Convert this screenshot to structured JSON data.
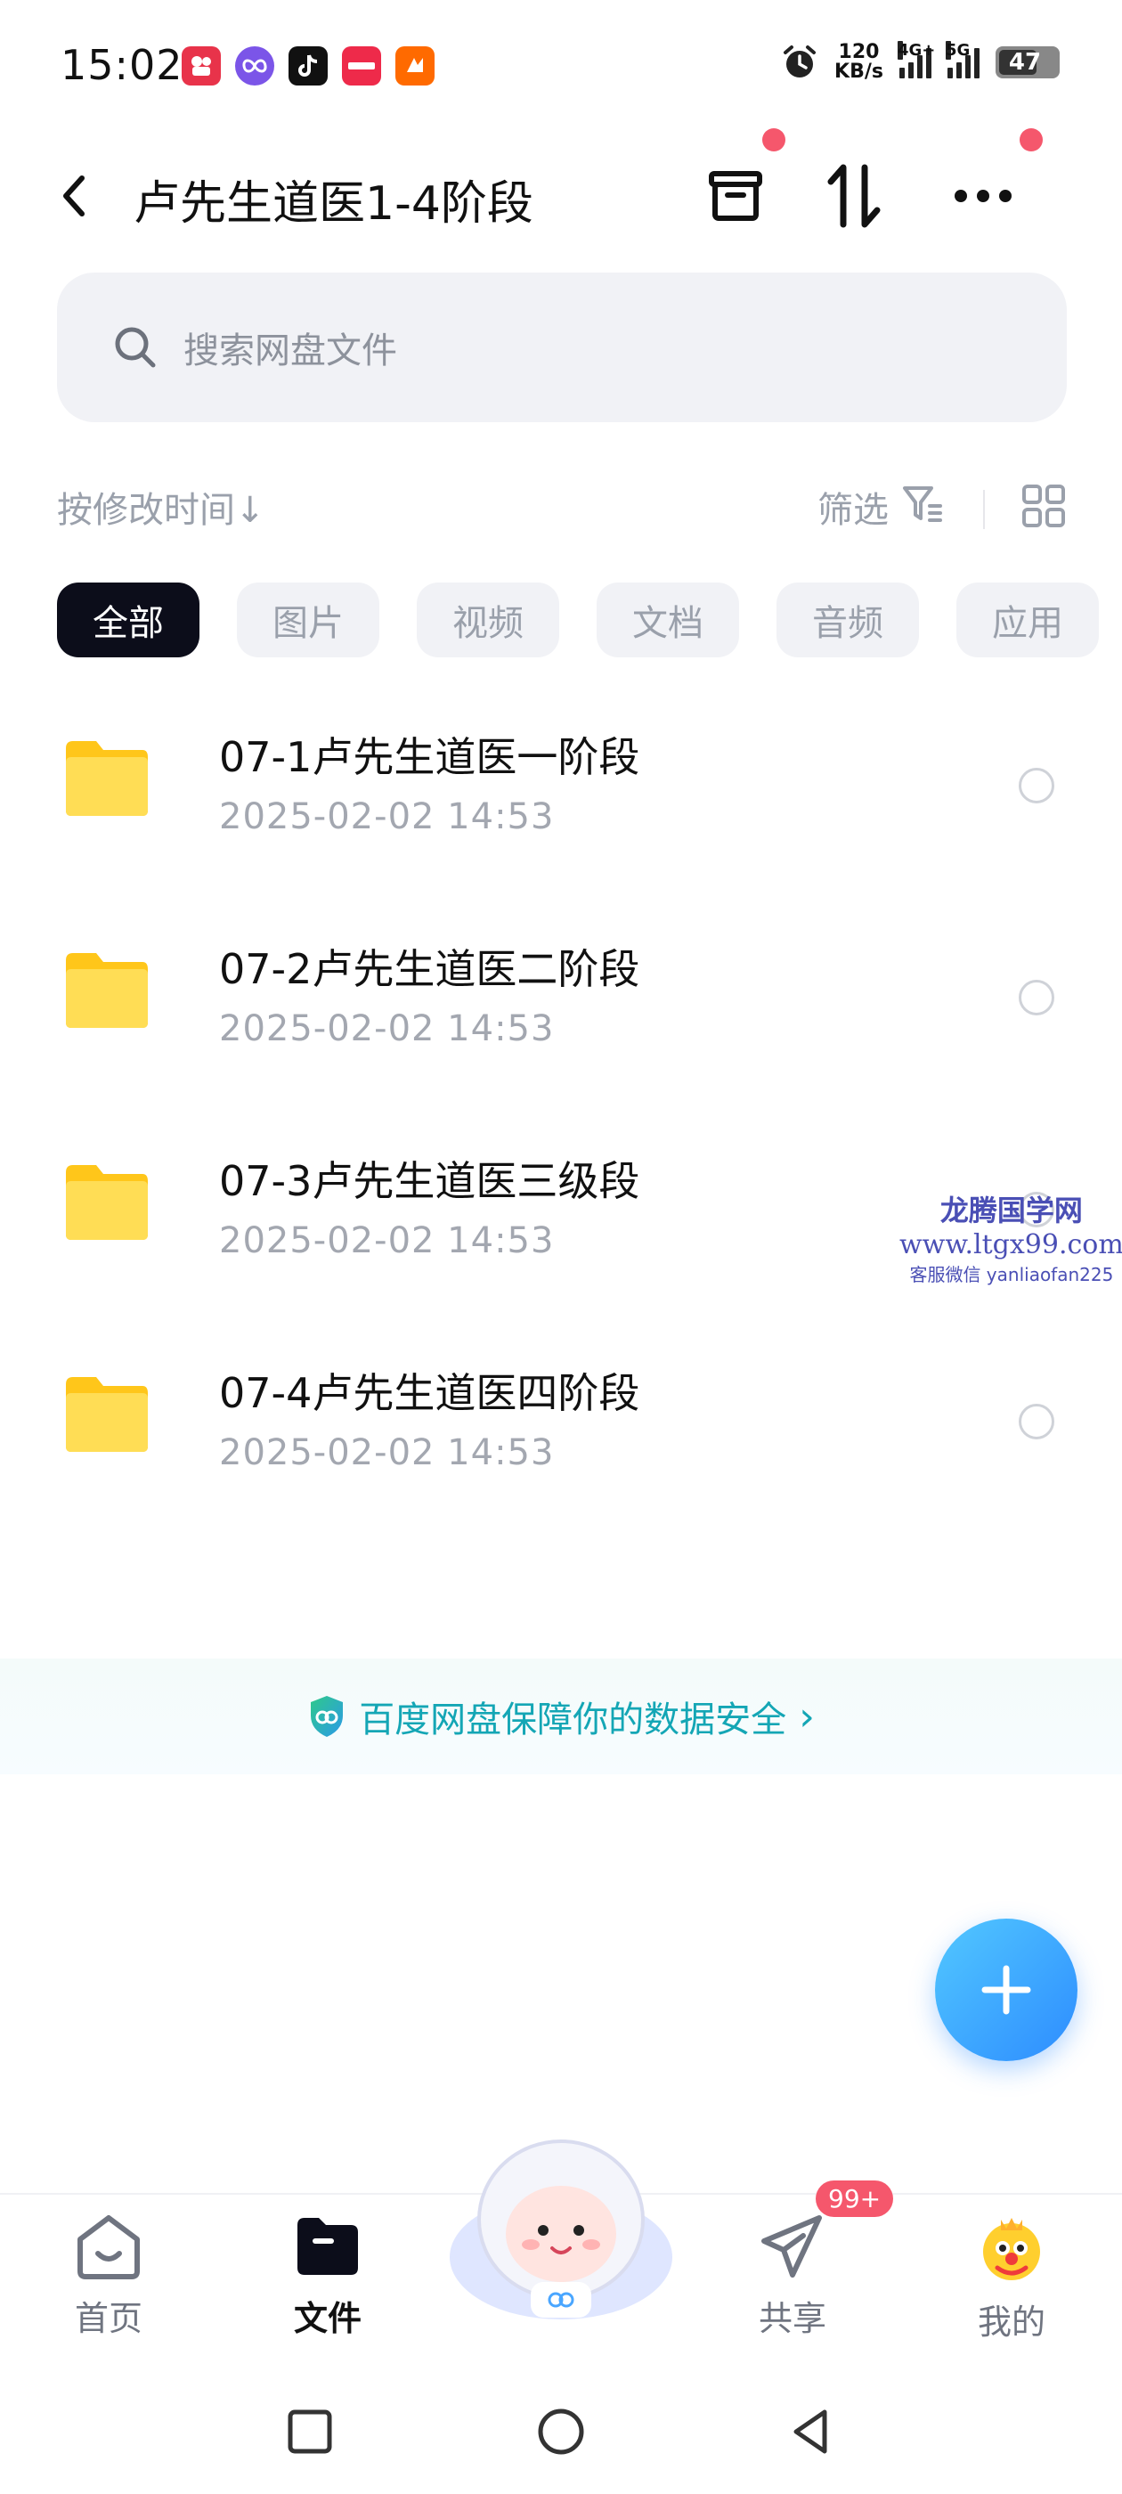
{
  "status_bar": {
    "time": "15:02",
    "net_speed_value": "120",
    "net_speed_unit": "KB/s",
    "network_1": "4G+",
    "network_2": "5G",
    "battery": "47",
    "app_icons": [
      "kuaishou-icon",
      "soul-icon",
      "douyin-icon",
      "xiaohongshu-icon",
      "taobao-icon"
    ]
  },
  "header": {
    "title": "卢先生道医1-4阶段",
    "icons": [
      "back-icon",
      "archive-icon",
      "sort-icon",
      "more-icon"
    ]
  },
  "search": {
    "placeholder": "搜索网盘文件"
  },
  "sort_bar": {
    "sort_label": "按修改时间",
    "sort_arrow": "↓",
    "filter_label": "筛选"
  },
  "chips": [
    "全部",
    "图片",
    "视频",
    "文档",
    "音频",
    "应用"
  ],
  "files": [
    {
      "name": "07-1卢先生道医一阶段",
      "date": "2025-02-02  14:53"
    },
    {
      "name": "07-2卢先生道医二阶段",
      "date": "2025-02-02  14:53"
    },
    {
      "name": "07-3卢先生道医三级段",
      "date": "2025-02-02  14:53"
    },
    {
      "name": "07-4卢先生道医四阶段",
      "date": "2025-02-02  14:53"
    }
  ],
  "watermark": {
    "line1": "龙腾国学网",
    "line2": "www.ltgx99.com",
    "line3": "客服微信 yanliaofan225"
  },
  "security_banner": {
    "text": "百度网盘保障你的数据安全",
    "arrow": "›"
  },
  "bottom_nav": {
    "items": [
      {
        "label": "首页",
        "icon": "home-icon"
      },
      {
        "label": "文件",
        "icon": "folder-icon"
      },
      {
        "label": "共享",
        "icon": "share-icon"
      },
      {
        "label": "我的",
        "icon": "profile-icon"
      }
    ],
    "share_badge": "99+"
  },
  "colors": {
    "accent": "#2d8cff",
    "security": "#14a6b5",
    "badge": "#f5576c",
    "folder": "#ffd23f"
  }
}
